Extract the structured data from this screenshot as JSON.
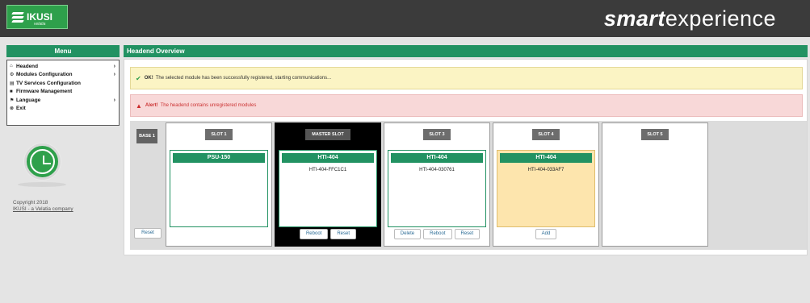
{
  "header": {
    "logo_text": "IKUSI",
    "logo_sub": "velatia",
    "brand_bold": "smart",
    "brand_light": "experience"
  },
  "sidebar": {
    "title": "Menu",
    "items": [
      {
        "icon": "home-icon",
        "glyph": "⌂",
        "label": "Headend",
        "arrow": "›"
      },
      {
        "icon": "gear-icon",
        "glyph": "⚙",
        "label": "Modules Configuration",
        "arrow": "›"
      },
      {
        "icon": "tv-icon",
        "glyph": "▤",
        "label": "TV Services Configuration",
        "arrow": ""
      },
      {
        "icon": "chip-icon",
        "glyph": "■",
        "label": "Firmware Management",
        "arrow": ""
      },
      {
        "icon": "flag-icon",
        "glyph": "⚑",
        "label": "Language",
        "arrow": "›"
      },
      {
        "icon": "exit-icon",
        "glyph": "⊗",
        "label": "Exit",
        "arrow": ""
      }
    ],
    "copyright": "Copyright 2018",
    "company_link": "IKUSI - a Velatia company"
  },
  "main": {
    "title": "Headend Overview",
    "alert_ok": {
      "strong": "OK!",
      "text": "The selected module has been successfully registered, starting communications..."
    },
    "alert_bad": {
      "strong": "Alert!",
      "text": "The headend contains unregistered modules"
    },
    "base_label": "BASE 1",
    "reset_label": "Reset",
    "slots": [
      {
        "label": "SLOT 1",
        "module": "PSU-150",
        "id": "",
        "buttons": []
      },
      {
        "label": "MASTER SLOT",
        "module": "HTI-404",
        "id": "HTI-404-FFC1C1",
        "buttons": [
          "Reboot",
          "Reset"
        ]
      },
      {
        "label": "SLOT 3",
        "module": "HTI-404",
        "id": "HTI-404-030761",
        "buttons": [
          "Delete",
          "Reboot",
          "Reset"
        ]
      },
      {
        "label": "SLOT 4",
        "module": "HTI-404",
        "id": "HTI-404-033AF7",
        "buttons": [
          "Add"
        ]
      },
      {
        "label": "SLOT 5",
        "module": "",
        "id": "",
        "buttons": []
      }
    ]
  },
  "colors": {
    "header_bg": "#3b3b3b",
    "accent_green": "#229262",
    "ok_bg": "#fbf4c4",
    "alert_bg": "#f8d8d8",
    "unregistered_bg": "#fde5ad"
  }
}
